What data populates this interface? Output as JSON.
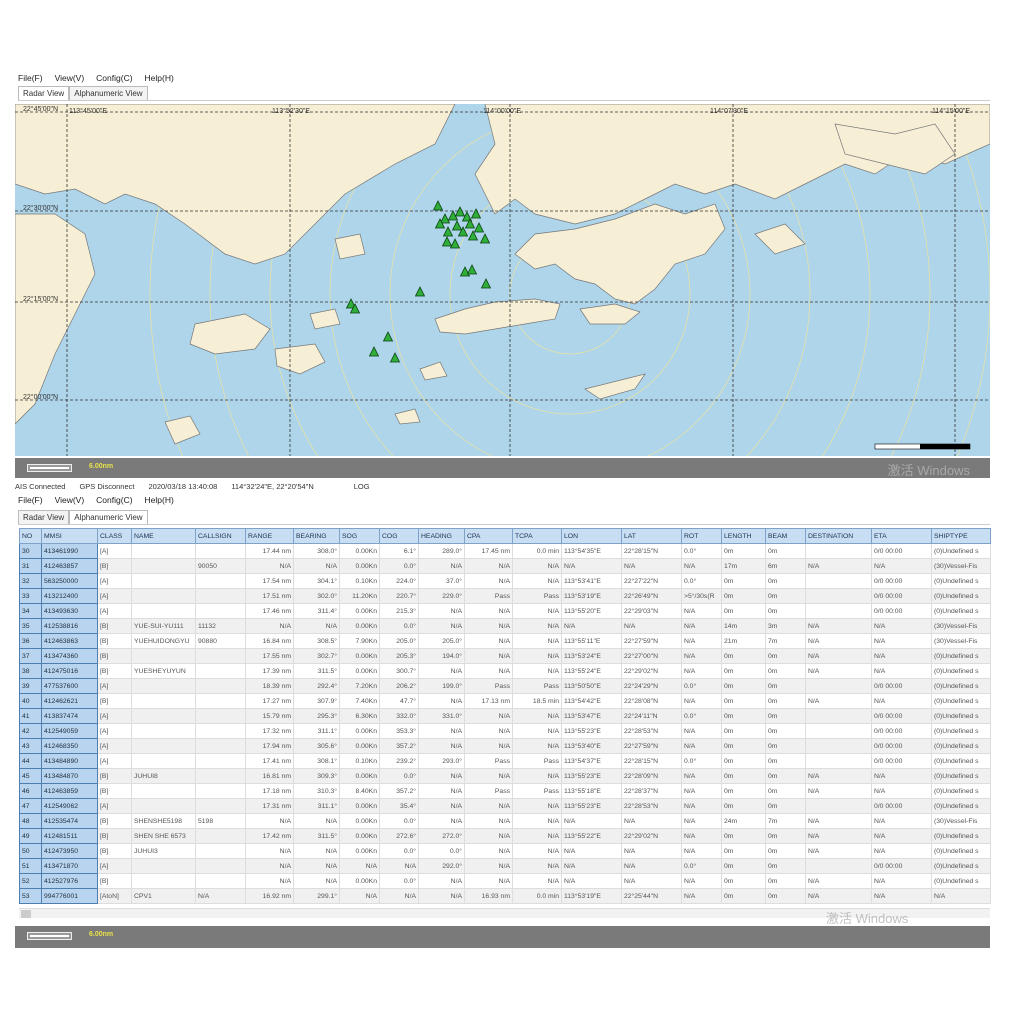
{
  "menu": [
    "File(F)",
    "View(V)",
    "Config(C)",
    "Help(H)"
  ],
  "tabs": [
    "Radar View",
    "Alphanumeric View"
  ],
  "map": {
    "lat_labels": [
      "22°45'00\"N",
      "22°30'00\"N",
      "22°15'00\"N",
      "22°00'00\"N"
    ],
    "lon_labels": [
      "113°45'00\"E",
      "113°52'30\"E",
      "114°00'00\"E",
      "114°07'30\"E",
      "114°15'00\"E"
    ],
    "colors": {
      "water": "#aed5ea",
      "land": "#f6efd6",
      "ship": "#2fae3a"
    }
  },
  "scale_label": "6.00nm",
  "watermark": "激活 Windows",
  "status": {
    "ais": "AIS Connected",
    "gps": "GPS Disconnect",
    "datetime": "2020/03/18 13:40:08",
    "position": "114°32'24\"E, 22°20'54\"N",
    "log": "LOG"
  },
  "table": {
    "columns": [
      "NO",
      "MMSI",
      "CLASS",
      "NAME",
      "CALLSIGN",
      "RANGE",
      "BEARING",
      "SOG",
      "COG",
      "HEADING",
      "CPA",
      "TCPA",
      "LON",
      "LAT",
      "ROT",
      "LENGTH",
      "BEAM",
      "DESTINATION",
      "ETA",
      "SHIPTYPE"
    ],
    "rows": [
      [
        "30",
        "413461990",
        "[A]",
        "",
        "",
        "17.44 nm",
        "308.0°",
        "0.00Kn",
        "6.1°",
        "289.0°",
        "17.45 nm",
        "0.0 min",
        "113°54'35\"E",
        "22°28'15\"N",
        "0.0°",
        "0m",
        "0m",
        "",
        "0/0 00:00",
        "(0)Undefined s"
      ],
      [
        "31",
        "412463857",
        "[B]",
        "",
        "90050",
        "N/A",
        "N/A",
        "0.00Kn",
        "0.0°",
        "N/A",
        "N/A",
        "N/A",
        "N/A",
        "N/A",
        "N/A",
        "17m",
        "6m",
        "N/A",
        "N/A",
        "(30)Vessel-Fis"
      ],
      [
        "32",
        "563250000",
        "[A]",
        "",
        "",
        "17.54 nm",
        "304.1°",
        "0.10Kn",
        "224.0°",
        "37.0°",
        "N/A",
        "N/A",
        "113°53'41\"E",
        "22°27'22\"N",
        "0.0°",
        "0m",
        "0m",
        "",
        "0/0 00:00",
        "(0)Undefined s"
      ],
      [
        "33",
        "413212400",
        "[A]",
        "",
        "",
        "17.51 nm",
        "302.0°",
        "11.20Kn",
        "220.7°",
        "229.0°",
        "Pass",
        "Pass",
        "113°53'19\"E",
        "22°26'49\"N",
        ">5°/30s(R",
        "0m",
        "0m",
        "",
        "0/0 00:00",
        "(0)Undefined s"
      ],
      [
        "34",
        "413493630",
        "[A]",
        "",
        "",
        "17.46 nm",
        "311.4°",
        "0.00Kn",
        "215.3°",
        "N/A",
        "N/A",
        "N/A",
        "113°55'20\"E",
        "22°29'03\"N",
        "N/A",
        "0m",
        "0m",
        "",
        "0/0 00:00",
        "(0)Undefined s"
      ],
      [
        "35",
        "412538816",
        "[B]",
        "YUE-SUI-YU111",
        "11132",
        "N/A",
        "N/A",
        "0.00Kn",
        "0.0°",
        "N/A",
        "N/A",
        "N/A",
        "N/A",
        "N/A",
        "N/A",
        "14m",
        "3m",
        "N/A",
        "N/A",
        "(30)Vessel-Fis"
      ],
      [
        "36",
        "412463863",
        "[B]",
        "YUEHUIDONGYU",
        "90880",
        "16.84 nm",
        "308.5°",
        "7.90Kn",
        "205.0°",
        "205.0°",
        "N/A",
        "N/A",
        "113°55'11\"E",
        "22°27'59\"N",
        "N/A",
        "21m",
        "7m",
        "N/A",
        "N/A",
        "(30)Vessel-Fis"
      ],
      [
        "37",
        "413474360",
        "[B]",
        "",
        "",
        "17.55 nm",
        "302.7°",
        "0.00Kn",
        "205.3°",
        "194.0°",
        "N/A",
        "N/A",
        "113°53'24\"E",
        "22°27'00\"N",
        "N/A",
        "0m",
        "0m",
        "N/A",
        "N/A",
        "(0)Undefined s"
      ],
      [
        "38",
        "412475016",
        "[B]",
        "YUESHEYUYUN",
        "",
        "17.39 nm",
        "311.5°",
        "0.00Kn",
        "300.7°",
        "N/A",
        "N/A",
        "N/A",
        "113°55'24\"E",
        "22°29'02\"N",
        "N/A",
        "0m",
        "0m",
        "N/A",
        "N/A",
        "(0)Undefined s"
      ],
      [
        "39",
        "477537600",
        "[A]",
        "",
        "",
        "18.39 nm",
        "292.4°",
        "7.20Kn",
        "206.2°",
        "199.0°",
        "Pass",
        "Pass",
        "113°50'50\"E",
        "22°24'29\"N",
        "0.0°",
        "0m",
        "0m",
        "",
        "0/0 00:00",
        "(0)Undefined s"
      ],
      [
        "40",
        "412462621",
        "[B]",
        "",
        "",
        "17.27 nm",
        "307.9°",
        "7.40Kn",
        "47.7°",
        "N/A",
        "17.13 nm",
        "18.5 min",
        "113°54'42\"E",
        "22°28'08\"N",
        "N/A",
        "0m",
        "0m",
        "N/A",
        "N/A",
        "(0)Undefined s"
      ],
      [
        "41",
        "413837474",
        "[A]",
        "",
        "",
        "15.79 nm",
        "295.3°",
        "6.30Kn",
        "332.0°",
        "331.0°",
        "N/A",
        "N/A",
        "113°53'47\"E",
        "22°24'11\"N",
        "0.0°",
        "0m",
        "0m",
        "",
        "0/0 00:00",
        "(0)Undefined s"
      ],
      [
        "42",
        "412549059",
        "[A]",
        "",
        "",
        "17.32 nm",
        "311.1°",
        "0.00Kn",
        "353.3°",
        "N/A",
        "N/A",
        "N/A",
        "113°55'23\"E",
        "22°28'53\"N",
        "N/A",
        "0m",
        "0m",
        "",
        "0/0 00:00",
        "(0)Undefined s"
      ],
      [
        "43",
        "412468350",
        "[A]",
        "",
        "",
        "17.94 nm",
        "305.6°",
        "0.00Kn",
        "357.2°",
        "N/A",
        "N/A",
        "N/A",
        "113°53'40\"E",
        "22°27'59\"N",
        "N/A",
        "0m",
        "0m",
        "",
        "0/0 00:00",
        "(0)Undefined s"
      ],
      [
        "44",
        "413484890",
        "[A]",
        "",
        "",
        "17.41 nm",
        "308.1°",
        "0.10Kn",
        "239.2°",
        "293.0°",
        "Pass",
        "Pass",
        "113°54'37\"E",
        "22°28'15\"N",
        "0.0°",
        "0m",
        "0m",
        "",
        "0/0 00:00",
        "(0)Undefined s"
      ],
      [
        "45",
        "413484870",
        "[B]",
        "JUHUI8",
        "",
        "16.81 nm",
        "309.3°",
        "0.00Kn",
        "0.0°",
        "N/A",
        "N/A",
        "N/A",
        "113°55'23\"E",
        "22°28'09\"N",
        "N/A",
        "0m",
        "0m",
        "N/A",
        "N/A",
        "(0)Undefined s"
      ],
      [
        "46",
        "412463859",
        "[B]",
        "",
        "",
        "17.18 nm",
        "310.3°",
        "8.40Kn",
        "357.2°",
        "N/A",
        "Pass",
        "Pass",
        "113°55'18\"E",
        "22°28'37\"N",
        "N/A",
        "0m",
        "0m",
        "N/A",
        "N/A",
        "(0)Undefined s"
      ],
      [
        "47",
        "412549062",
        "[A]",
        "",
        "",
        "17.31 nm",
        "311.1°",
        "0.00Kn",
        "35.4°",
        "N/A",
        "N/A",
        "N/A",
        "113°55'23\"E",
        "22°28'53\"N",
        "N/A",
        "0m",
        "0m",
        "",
        "0/0 00:00",
        "(0)Undefined s"
      ],
      [
        "48",
        "412535474",
        "[B]",
        "SHENSHE5198",
        "5198",
        "N/A",
        "N/A",
        "0.00Kn",
        "0.0°",
        "N/A",
        "N/A",
        "N/A",
        "N/A",
        "N/A",
        "N/A",
        "24m",
        "7m",
        "N/A",
        "N/A",
        "(30)Vessel-Fis"
      ],
      [
        "49",
        "412481511",
        "[B]",
        "SHEN SHE 6573",
        "",
        "17.42 nm",
        "311.5°",
        "0.00Kn",
        "272.6°",
        "272.0°",
        "N/A",
        "N/A",
        "113°55'22\"E",
        "22°29'02\"N",
        "N/A",
        "0m",
        "0m",
        "N/A",
        "N/A",
        "(0)Undefined s"
      ],
      [
        "50",
        "412473950",
        "[B]",
        "JUHUI3",
        "",
        "N/A",
        "N/A",
        "0.00Kn",
        "0.0°",
        "0.0°",
        "N/A",
        "N/A",
        "N/A",
        "N/A",
        "N/A",
        "0m",
        "0m",
        "N/A",
        "N/A",
        "(0)Undefined s"
      ],
      [
        "51",
        "413471870",
        "[A]",
        "",
        "",
        "N/A",
        "N/A",
        "N/A",
        "N/A",
        "292.0°",
        "N/A",
        "N/A",
        "N/A",
        "N/A",
        "0.0°",
        "0m",
        "0m",
        "",
        "0/0 00:00",
        "(0)Undefined s"
      ],
      [
        "52",
        "412527976",
        "[B]",
        "",
        "",
        "N/A",
        "N/A",
        "0.00Kn",
        "0.0°",
        "N/A",
        "N/A",
        "N/A",
        "N/A",
        "N/A",
        "N/A",
        "0m",
        "0m",
        "N/A",
        "N/A",
        "(0)Undefined s"
      ],
      [
        "53",
        "994776001",
        "[AtoN]",
        "CPV1",
        "N/A",
        "16.92 nm",
        "299.1°",
        "N/A",
        "N/A",
        "N/A",
        "16.93 nm",
        "0.0 min",
        "113°53'19\"E",
        "22°25'44\"N",
        "N/A",
        "0m",
        "0m",
        "N/A",
        "N/A",
        "N/A"
      ]
    ]
  }
}
